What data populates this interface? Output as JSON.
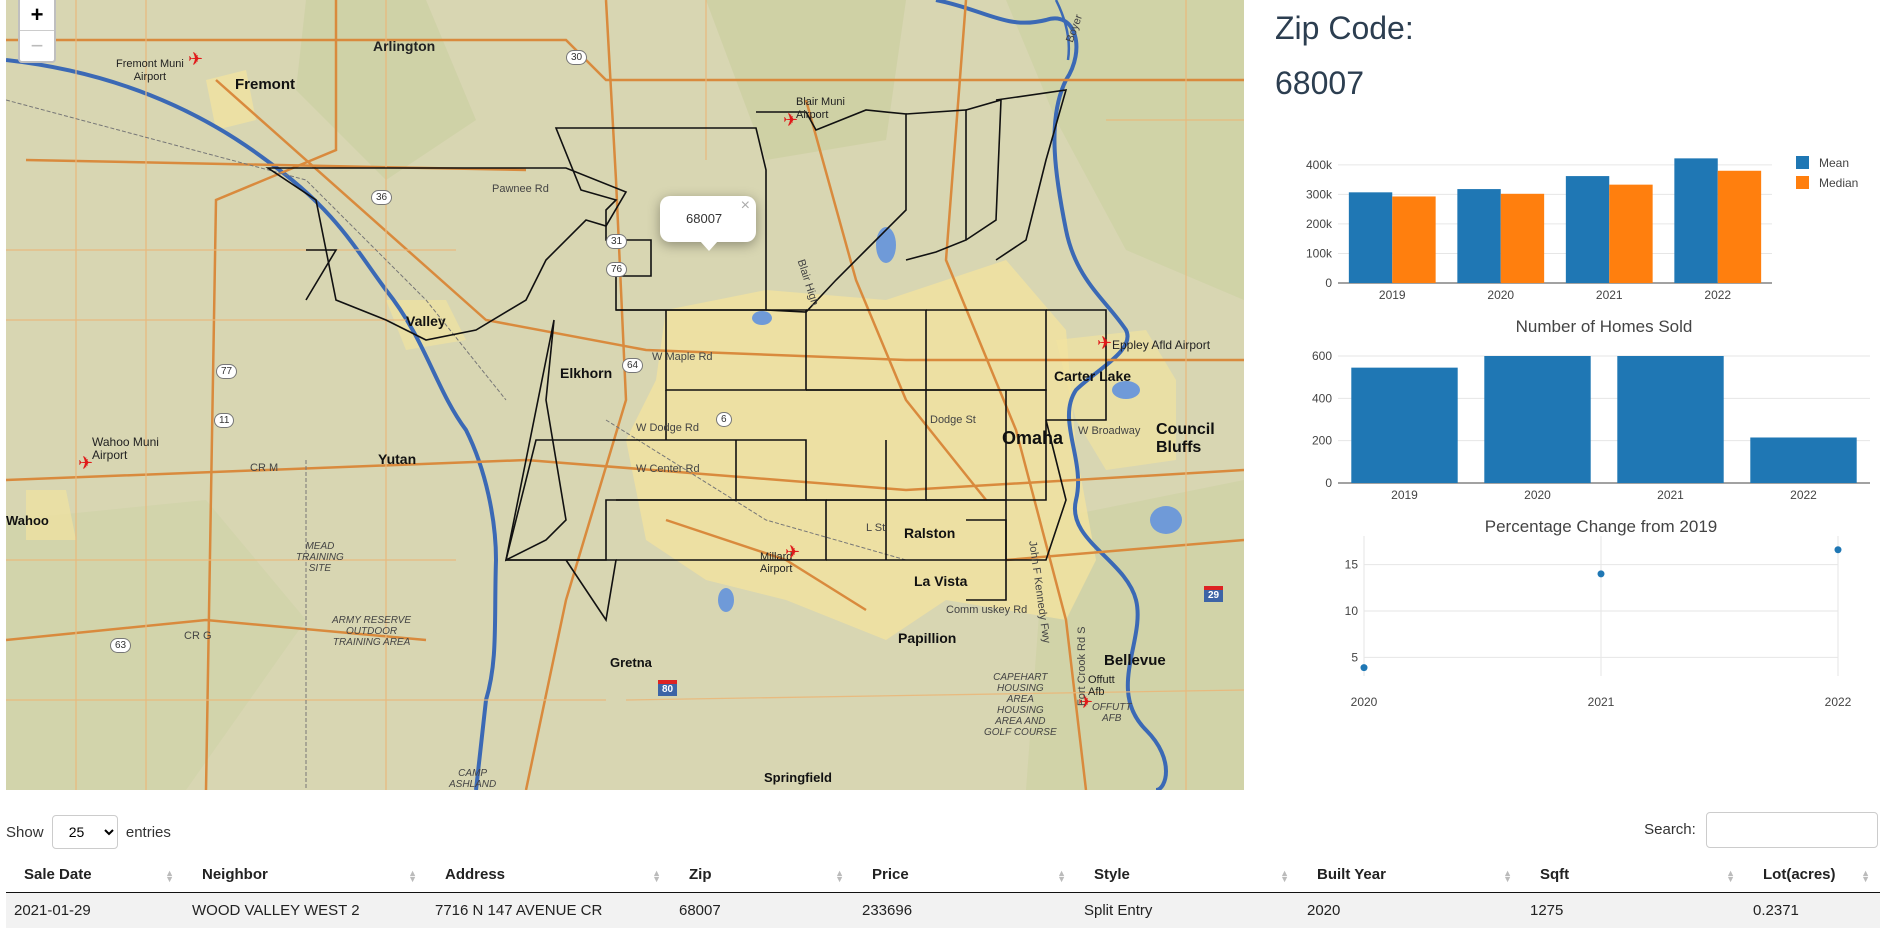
{
  "map": {
    "zoom_in": "+",
    "zoom_out": "−",
    "popup_text": "68007",
    "popup_close": "×",
    "labels": {
      "fremont_muni_airport": "Fremont Muni\nAirport",
      "fremont": "Fremont",
      "arlington": "Arlington",
      "blair_muni_airport": "Blair Muni\nAirport",
      "pawnee_rd": "Pawnee Rd",
      "valley": "Valley",
      "elkhorn": "Elkhorn",
      "w_maple_rd": "W Maple Rd",
      "w_dodge_rd": "W Dodge Rd",
      "w_center_rd": "W Center Rd",
      "dodge_st": "Dodge St",
      "w_broadway": "W Broadway",
      "omaha": "Omaha",
      "council_bluffs": "Council\nBluffs",
      "carter_lake": "Carter Lake",
      "eppley": "Eppley Afld Airport",
      "wahoo_muni": "Wahoo Muni\nAirport",
      "yutan": "Yutan",
      "cr_m": "CR M",
      "wahoo": "Wahoo",
      "mead": "MEAD\nTRAINING\nSITE",
      "army": "ARMY RESERVE\nOUTDOOR\nTRAINING AREA",
      "crg": "CR G",
      "gretna": "Gretna",
      "millard": "Millard\nAirport",
      "l_st": "L St",
      "ralston": "Ralston",
      "la_vista": "La Vista",
      "papillion": "Papillion",
      "bellevue": "Bellevue",
      "offutt": "Offutt\nAfb",
      "offutt_afb": "OFFUTT\nAFB",
      "capehart": "CAPEHART\nHOUSING\nAREA\nHOUSING\nAREA AND\nGOLF COURSE",
      "camp_ashland": "CAMP\nASHLAND",
      "springfield": "Springfield",
      "commuter": "Comm uskey Rd",
      "blair_hwy": "Blair High",
      "kennedy": "John F Kennedy Fwy",
      "fort_crook": "Fort Crook Rd S",
      "boyer": "Boyer"
    },
    "shields": {
      "s30": "30",
      "s36": "36",
      "s31": "31",
      "s76": "76",
      "s64": "64",
      "s6": "6",
      "s77": "77",
      "s11": "11",
      "s63": "63",
      "s80": "80",
      "s29": "29"
    }
  },
  "panel": {
    "zip_title": "Zip Code:",
    "zip_value": "68007"
  },
  "chart_data": [
    {
      "type": "bar",
      "title": "",
      "categories": [
        "2019",
        "2020",
        "2021",
        "2022"
      ],
      "series": [
        {
          "name": "Mean",
          "color": "#1f77b4",
          "values": [
            307000,
            318000,
            362000,
            422000
          ]
        },
        {
          "name": "Median",
          "color": "#ff7f0e",
          "values": [
            293000,
            302000,
            333000,
            380000
          ]
        }
      ],
      "ylim": [
        0,
        430000
      ],
      "yticks": [
        "0",
        "100k",
        "200k",
        "300k",
        "400k"
      ],
      "ytick_values": [
        0,
        100000,
        200000,
        300000,
        400000
      ],
      "legend": "top-right",
      "grid": true
    },
    {
      "type": "bar",
      "title": "Number of Homes Sold",
      "categories": [
        "2019",
        "2020",
        "2021",
        "2022"
      ],
      "series": [
        {
          "color": "#1f77b4",
          "values": [
            545,
            600,
            600,
            215
          ]
        }
      ],
      "ylim": [
        0,
        600
      ],
      "yticks": [
        "0",
        "200",
        "400",
        "600"
      ],
      "ytick_values": [
        0,
        200,
        400,
        600
      ],
      "grid": true
    },
    {
      "type": "scatter",
      "title": "Percentage Change from 2019",
      "categories": [
        "2020",
        "2021",
        "2022"
      ],
      "series": [
        {
          "color": "#1f77b4",
          "values": [
            3.9,
            14.0,
            16.6
          ]
        }
      ],
      "ylim": [
        3,
        17
      ],
      "yticks": [
        "5",
        "10",
        "15"
      ],
      "ytick_values": [
        5,
        10,
        15
      ],
      "grid": true
    }
  ],
  "table": {
    "show_label": "Show",
    "entries_label": "entries",
    "page_size": "25",
    "search_label": "Search:",
    "columns": [
      "Sale Date",
      "Neighbor",
      "Address",
      "Zip",
      "Price",
      "Style",
      "Built Year",
      "Sqft",
      "Lot(acres)"
    ],
    "rows": [
      [
        "2021-01-29",
        "WOOD VALLEY WEST 2",
        "7716 N 147 AVENUE CR",
        "68007",
        "233696",
        "Split Entry",
        "2020",
        "1275",
        "0.2371"
      ]
    ]
  }
}
